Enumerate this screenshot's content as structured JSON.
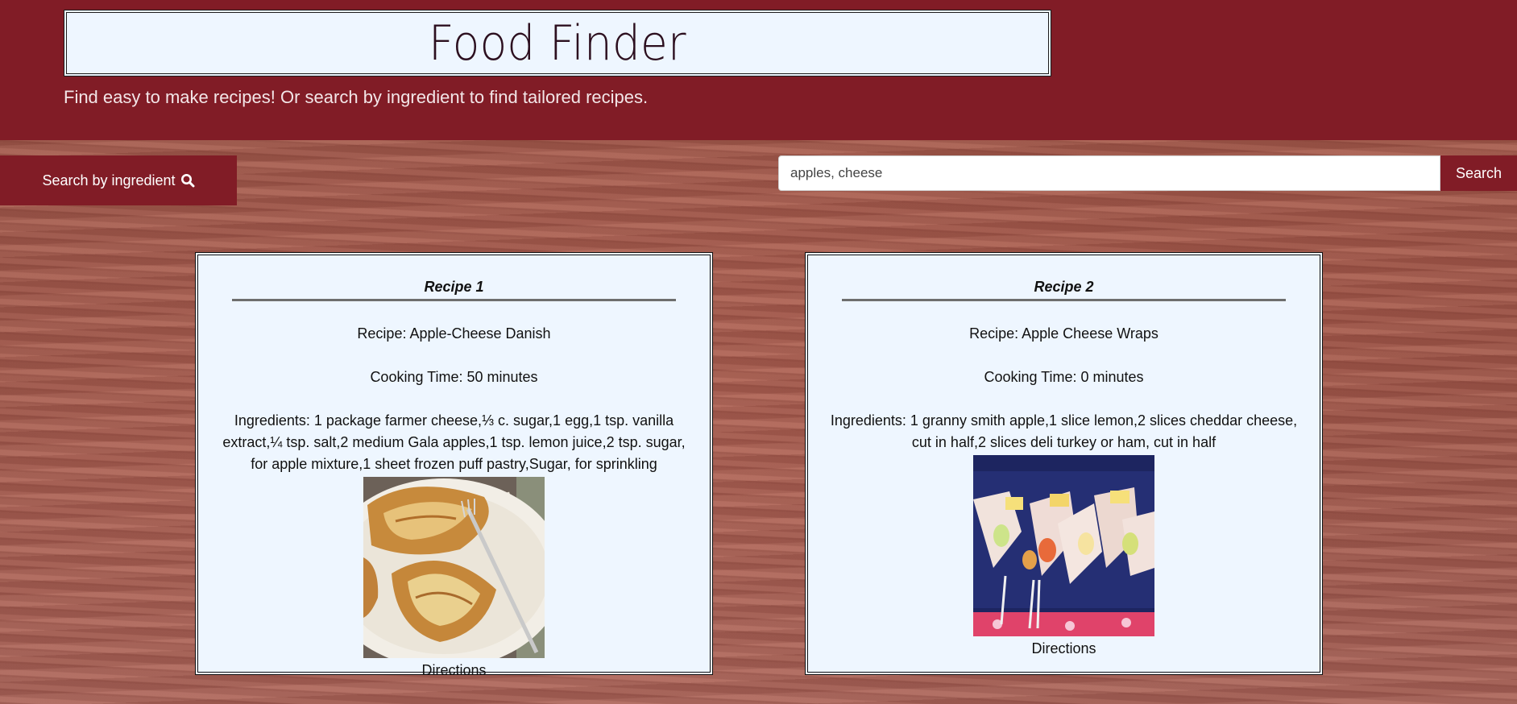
{
  "header": {
    "title": "Food Finder",
    "subtitle": "Find easy to make recipes! Or search by ingredient to find tailored recipes."
  },
  "toolbar": {
    "ingredient_button_label": "Search by ingredient",
    "ingredient_button_icon": "search-icon",
    "search_value": "apples, cheese",
    "search_button_label": "Search"
  },
  "recipes": [
    {
      "heading": "Recipe 1",
      "name": "Recipe: Apple-Cheese Danish",
      "cooking_time": "Cooking Time: 50 minutes",
      "ingredients": "Ingredients: 1 package farmer cheese,⅓ c. sugar,1 egg,1 tsp. vanilla extract,¼ tsp. salt,2 medium Gala apples,1 tsp. lemon juice,2 tsp. sugar, for apple mixture,1 sheet frozen puff pastry,Sugar, for sprinkling",
      "image": "apple-cheese-danish-photo",
      "directions_label": "Directions"
    },
    {
      "heading": "Recipe 2",
      "name": "Recipe: Apple Cheese Wraps",
      "cooking_time": "Cooking Time: 0 minutes",
      "ingredients": "Ingredients: 1 granny smith apple,1 slice lemon,2 slices cheddar cheese, cut in half,2 slices deli turkey or ham, cut in half",
      "image": "apple-cheese-wraps-photo",
      "directions_label": "Directions"
    }
  ],
  "colors": {
    "brand": "#811c26",
    "card_background": "#eef6ff",
    "wood_background": "#a45e52"
  }
}
